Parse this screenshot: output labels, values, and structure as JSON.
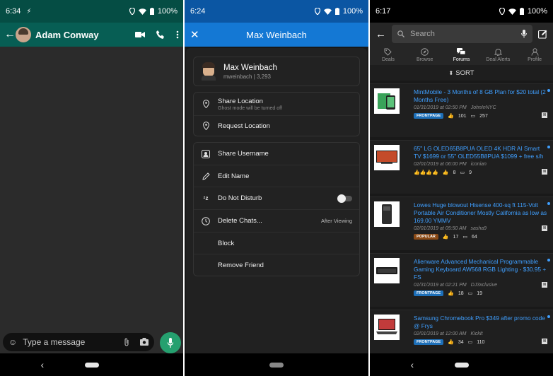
{
  "screen1": {
    "time": "6:34",
    "battery": "100%",
    "contact_name": "Adam Conway",
    "input_placeholder": "Type a message"
  },
  "screen2": {
    "time": "6:24",
    "battery": "100%",
    "title": "Max Weinbach",
    "profile": {
      "name": "Max Weinbach",
      "subtitle": "mweinbach | 3,293"
    },
    "location_items": [
      {
        "label": "Share Location",
        "sub": "Ghost mode will be turned off",
        "icon": "location-pin-icon"
      },
      {
        "label": "Request Location",
        "sub": "",
        "icon": "location-pin-icon"
      }
    ],
    "action_items": [
      {
        "label": "Share Username",
        "meta": "",
        "icon": "share-username-icon"
      },
      {
        "label": "Edit Name",
        "meta": "",
        "icon": "pencil-icon"
      },
      {
        "label": "Do Not Disturb",
        "meta": "",
        "icon": "zzz-icon"
      },
      {
        "label": "Delete Chats...",
        "meta": "After Viewing",
        "icon": "clock-icon"
      },
      {
        "label": "Block",
        "meta": "",
        "icon": ""
      },
      {
        "label": "Remove Friend",
        "meta": "",
        "icon": ""
      }
    ]
  },
  "screen3": {
    "time": "6:17",
    "battery": "100%",
    "search_placeholder": "Search",
    "tabs": [
      {
        "label": "Deals",
        "icon": "tag-icon"
      },
      {
        "label": "Browse",
        "icon": "compass-icon"
      },
      {
        "label": "Forums",
        "icon": "chat-bubbles-icon"
      },
      {
        "label": "Deal Alerts",
        "icon": "bell-icon"
      },
      {
        "label": "Profile",
        "icon": "person-icon"
      }
    ],
    "sort_label": "SORT",
    "deals": [
      {
        "title": "MintMobile - 3 Months of 8 GB Plan for $20 total (2 Months Free)",
        "date": "01/31/2019 at 02:50 PM",
        "user": "JohnInNYC",
        "badge": "FRONTPAGE",
        "thumbs": "101",
        "comments": "257",
        "thumb_type": "mint"
      },
      {
        "title": "65\" LG OLED65B8PUA OLED 4K HDR AI Smart TV $1699 or 55\" OLED55B8PUA $1099 + free s/h",
        "date": "02/01/2019 at 06:00 PM",
        "user": "iconian",
        "badge": "",
        "thumbs": "8",
        "comments": "9",
        "thumb_type": "tv"
      },
      {
        "title": "Lowes Huge blowout  Hisense 400-sq ft 115-Volt Portable Air Conditioner Mostly California as low as 169.00 YMMV",
        "date": "02/01/2019 at 05:50 AM",
        "user": "sasha9",
        "badge": "POPULAR",
        "thumbs": "17",
        "comments": "64",
        "thumb_type": "ac"
      },
      {
        "title": "Alienware Advanced Mechanical Programmable Gaming Keyboard AW568 RGB Lighting - $30.95 + FS",
        "date": "01/31/2019 at 02:21 PM",
        "user": "DJ3xclusive",
        "badge": "FRONTPAGE",
        "thumbs": "18",
        "comments": "19",
        "thumb_type": "keyboard"
      },
      {
        "title": "Samsung Chromebook Pro $349 after promo code @ Frys",
        "date": "02/01/2019 at 12:00 AM",
        "user": "KickIt",
        "badge": "FRONTPAGE",
        "thumbs": "34",
        "comments": "110",
        "thumb_type": "laptop"
      }
    ]
  },
  "colors": {
    "whatsapp_header": "#075e54",
    "snapchat_header": "#1478d4",
    "slickdeals_link": "#3f9fff",
    "frontpage_badge": "#1d6fb8",
    "popular_badge": "#8a4a16"
  }
}
